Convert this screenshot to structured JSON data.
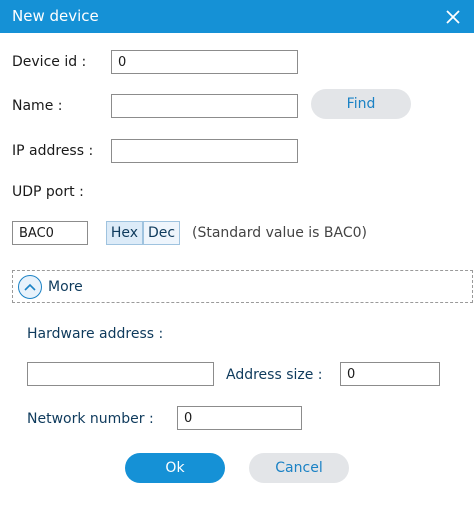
{
  "window": {
    "title": "New device",
    "close_icon": "close-icon",
    "accent_color": "#1591d6"
  },
  "form": {
    "device_id_label": "Device id :",
    "device_id_value": "0",
    "name_label": "Name :",
    "name_value": "",
    "find_label": "Find",
    "ip_label": "IP address :",
    "ip_value": "",
    "udp_label": "UDP port :",
    "udp_value": "BAC0",
    "hex_label": "Hex",
    "dec_label": "Dec",
    "udp_hint": "(Standard value is BAC0)"
  },
  "more": {
    "label": "More",
    "toggle_icon": "chevron-up-icon",
    "hardware_address_label": "Hardware address :",
    "hardware_address_value": "",
    "address_size_label": "Address size :",
    "address_size_value": "0",
    "network_number_label": "Network number :",
    "network_number_value": "0"
  },
  "buttons": {
    "ok_label": "Ok",
    "cancel_label": "Cancel"
  }
}
